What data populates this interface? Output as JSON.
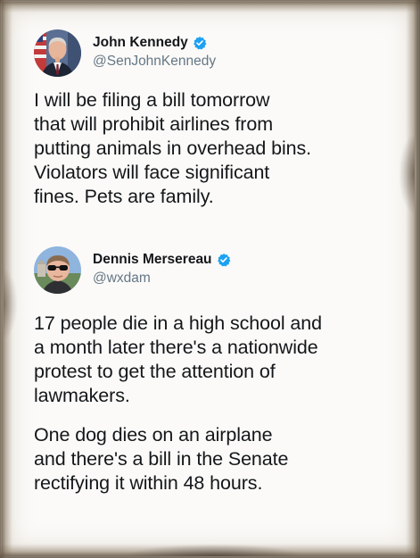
{
  "tweets": [
    {
      "author": {
        "name": "John Kennedy",
        "handle": "@SenJohnKennedy",
        "verified": true,
        "avatar_icon": "avatar-photo-man-with-flag"
      },
      "text_lines": [
        "I will be filing a bill tomorrow",
        "that will prohibit airlines from",
        "putting animals in overhead bins.",
        "Violators will face significant",
        "fines. Pets are family."
      ]
    },
    {
      "author": {
        "name": "Dennis Mersereau",
        "handle": "@wxdam",
        "verified": true,
        "avatar_icon": "avatar-photo-man-with-sunglasses"
      },
      "paragraphs": [
        {
          "lines": [
            "17 people die in a high school and",
            "a month later there's a nationwide",
            "protest to get the attention of",
            "lawmakers."
          ]
        },
        {
          "lines": [
            "One dog dies on an airplane",
            "and there's a bill in the Senate",
            "rectifying it within 48 hours."
          ]
        }
      ]
    }
  ],
  "colors": {
    "verified_badge": "#1da1f2",
    "handle_text": "#657786",
    "body_text": "#14171a",
    "paper": "#fbfaf8"
  }
}
